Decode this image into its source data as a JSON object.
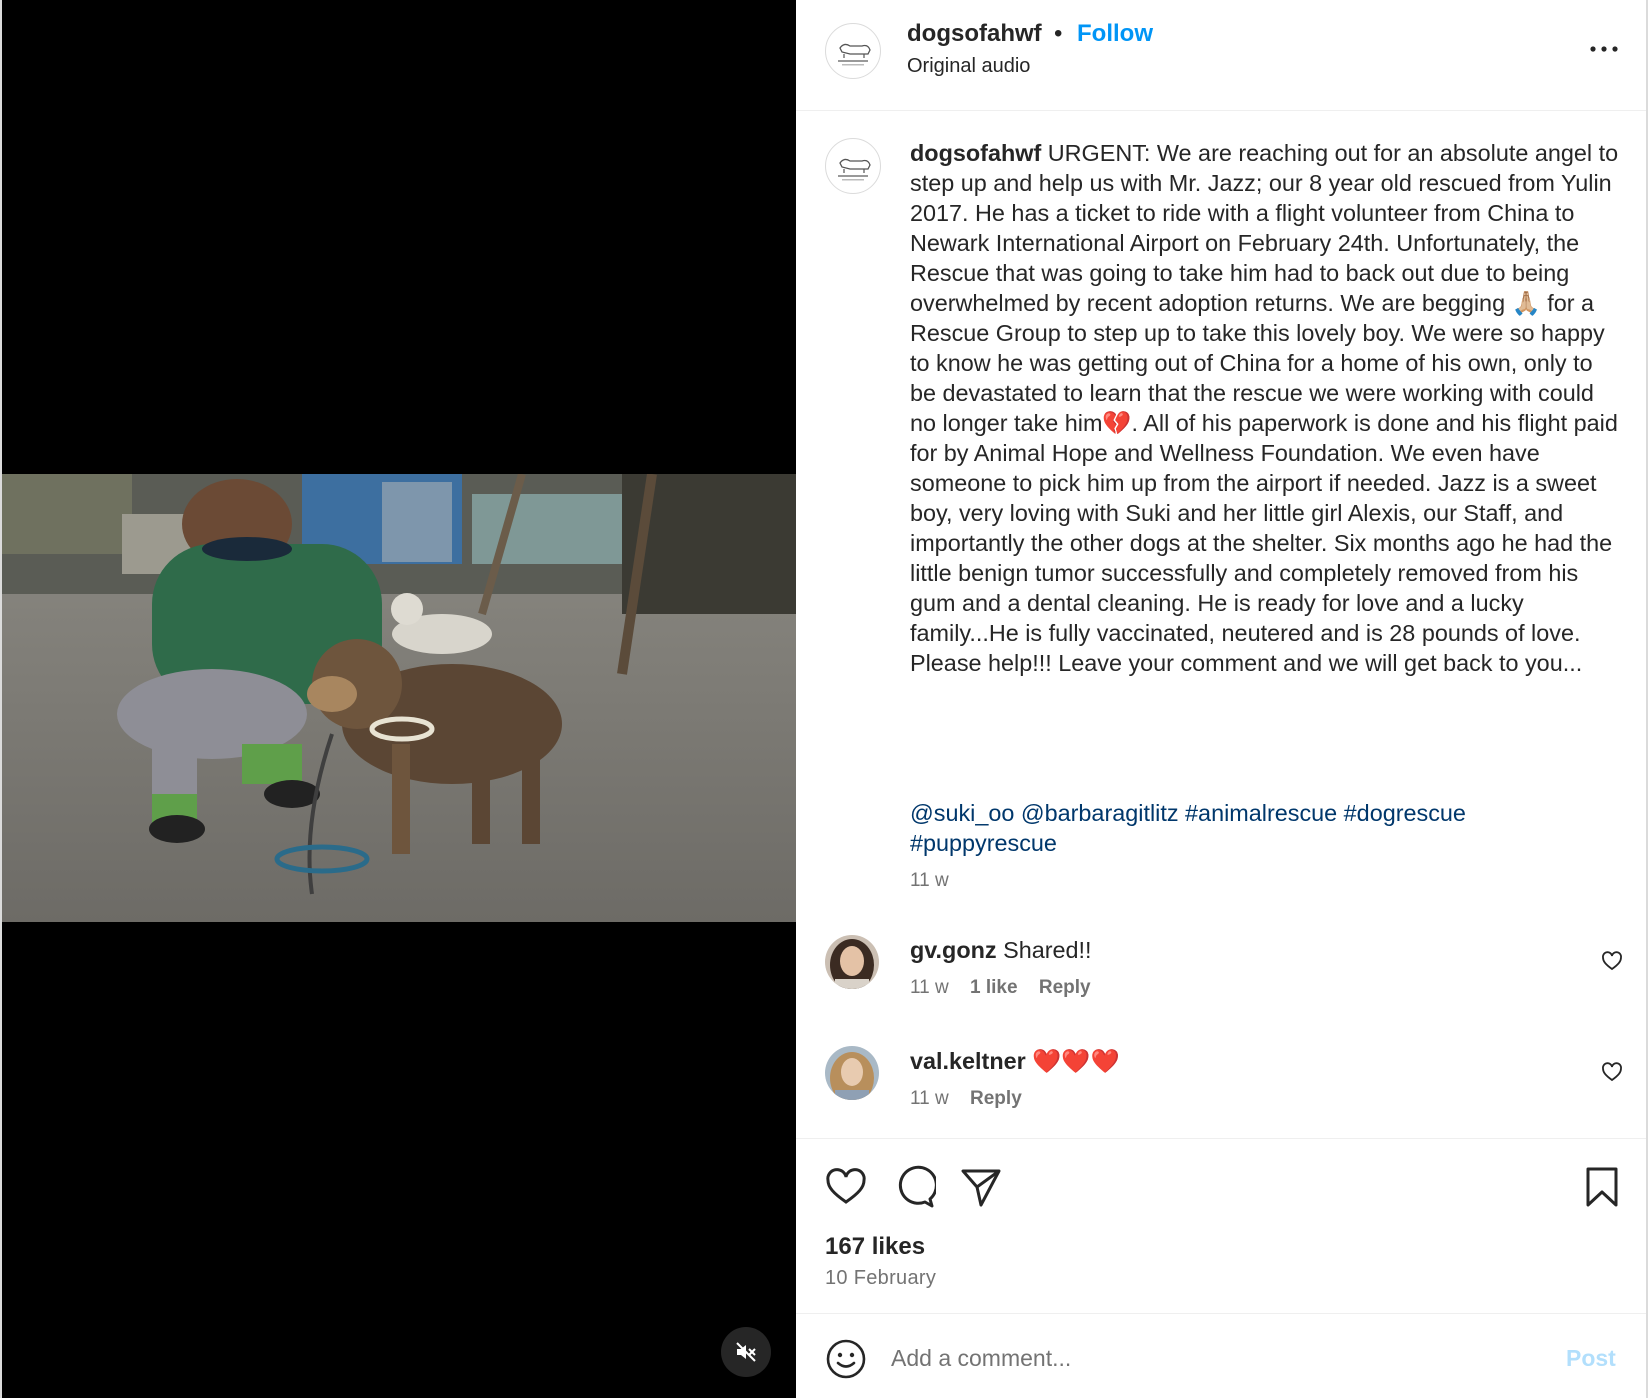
{
  "header": {
    "username": "dogsofahwf",
    "separator": "•",
    "follow_label": "Follow",
    "audio_label": "Original audio",
    "more_icon": "more-horizontal-icon"
  },
  "caption": {
    "username": "dogsofahwf",
    "text": "URGENT: We are reaching out for an absolute angel to step up and help us with Mr. Jazz; our 8 year old rescued from Yulin 2017. He has a ticket to ride with a flight volunteer from China to Newark International Airport on February 24th. Unfortunately, the Rescue that was going to take him had to back out due to being overwhelmed by recent adoption returns. We are begging 🙏🏼 for a Rescue Group to step up to take this lovely boy. We were so happy to know he was getting out of China for a home of his own, only to be devastated to learn that the rescue we were working with could no longer take him💔. All of his paperwork is done and his flight paid for by Animal Hope and Wellness Foundation. We even have someone to pick him up from the airport if needed. Jazz is a sweet boy, very loving with Suki and her little girl Alexis, our Staff, and importantly the other dogs at the shelter. Six months ago he had the little benign tumor successfully and completely removed from his gum and a dental cleaning. He is ready for love and a lucky family...He is fully vaccinated, neutered and is 28 pounds of love. Please help!!! Leave your comment and we will get back to you...",
    "tags": [
      "@suki_oo",
      "@barbaragitlitz",
      "#animalrescue",
      "#dogrescue",
      "#puppyrescue"
    ],
    "time": "11 w"
  },
  "comments": [
    {
      "username": "gv.gonz",
      "text": "Shared!!",
      "time": "11 w",
      "likes": "1 like",
      "reply": "Reply"
    },
    {
      "username": "val.keltner",
      "text": "❤️❤️❤️",
      "time": "11 w",
      "reply": "Reply"
    }
  ],
  "actions": {
    "likes": "167 likes",
    "date": "10 February"
  },
  "comment_box": {
    "placeholder": "Add a comment...",
    "post_label": "Post"
  },
  "colors": {
    "follow": "#0095f6",
    "tag": "#00376b",
    "secondary_text": "#737373",
    "post_disabled": "#b2dffc"
  }
}
